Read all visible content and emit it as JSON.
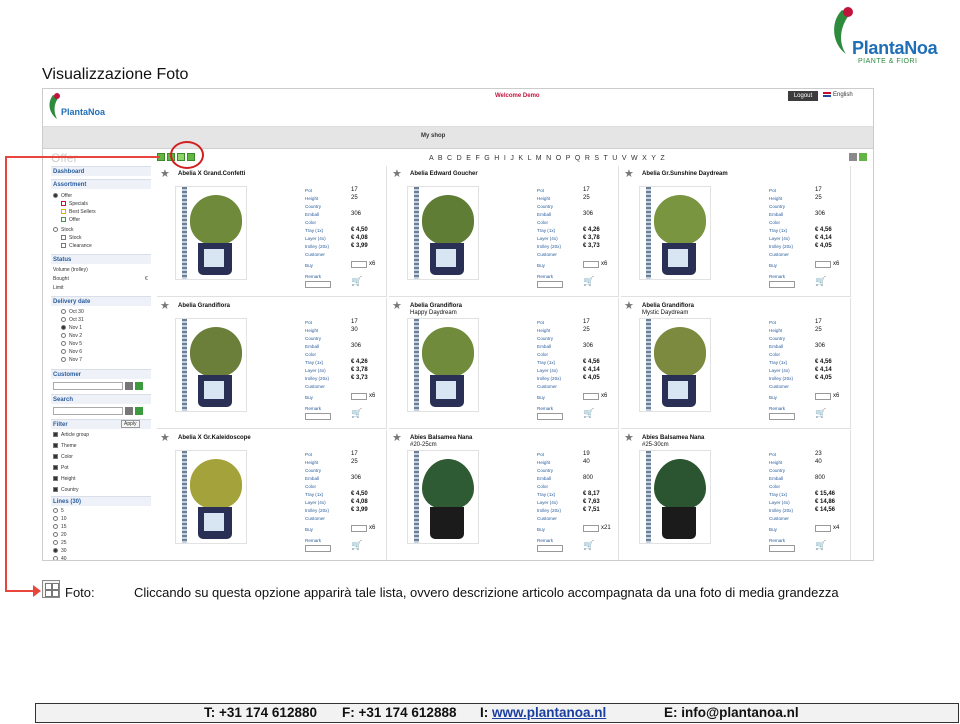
{
  "brand": {
    "name": "PlantaNoa",
    "tagline": "PIANTE & FIORI"
  },
  "doc_title": "Visualizzazione Foto",
  "app": {
    "logo_name": "PlantaNoa",
    "welcome": "Welcome Demo",
    "logout": "Logout",
    "language": "English",
    "shop_title": "My shop",
    "offer_title": "Offer",
    "alphabet": "A B C D E F G H I J K L M N O P Q R S T U V W X Y Z"
  },
  "sidebar": {
    "dashboard": "Dashboard",
    "assortment": "Assortment",
    "offer": "Offer",
    "specials": "Specials",
    "best_sellers": "Best Sellers",
    "offer2": "Offer",
    "stock_group": "Stock",
    "stock": "Stock",
    "clearance": "Clearance",
    "status": "Status",
    "volume": "Volume (trolley)",
    "bought": "Bought",
    "bought_sym": "€",
    "limit": "Limit",
    "delivery_date": "Delivery date",
    "dates": [
      "Oct 30",
      "Oct 31",
      "Nov 1",
      "Nov 2",
      "Nov 5",
      "Nov 6",
      "Nov 7"
    ],
    "customer": "Customer",
    "search": "Search",
    "filter": "Filter",
    "apply": "Apply",
    "filters": [
      "Article group",
      "Theme",
      "Color",
      "Pot",
      "Height",
      "Country"
    ],
    "lines": "Lines (30)",
    "line_options": [
      "5",
      "10",
      "15",
      "20",
      "25",
      "30",
      "40"
    ]
  },
  "spec_labels": {
    "pot": "Pot",
    "height": "Height",
    "country": "Country",
    "emball": "Emball",
    "color": "Color",
    "tray": "Tray (1x)",
    "layer": "Layer (4x)",
    "trolley": "trolley (20x)",
    "customer": "Customer",
    "buy": "Buy",
    "remark": "Remark"
  },
  "products": [
    {
      "name": "Abelia X Grand.Confetti",
      "sub": "",
      "pot": "17",
      "height": "25",
      "emball": "306",
      "tray": "€ 4,50",
      "layer": "€ 4,08",
      "trolley": "€ 3,99",
      "mult": "x6",
      "leaf": "#6e8a3a"
    },
    {
      "name": "Abelia Edward Goucher",
      "sub": "",
      "pot": "17",
      "height": "25",
      "emball": "306",
      "tray": "€ 4,26",
      "layer": "€ 3,78",
      "trolley": "€ 3,73",
      "mult": "x6",
      "leaf": "#5f7d34"
    },
    {
      "name": "Abelia Gr.Sunshine Daydream",
      "sub": "",
      "pot": "17",
      "height": "25",
      "emball": "306",
      "tray": "€ 4,56",
      "layer": "€ 4,14",
      "trolley": "€ 4,05",
      "mult": "x6",
      "leaf": "#7a9540"
    },
    {
      "name": "Abelia Grandiflora",
      "sub": "",
      "pot": "17",
      "height": "30",
      "emball": "306",
      "tray": "€ 4,26",
      "layer": "€ 3,78",
      "trolley": "€ 3,73",
      "mult": "x6",
      "leaf": "#6b7e3a"
    },
    {
      "name": "Abelia Grandiflora",
      "sub": "Happy Daydream",
      "pot": "17",
      "height": "25",
      "emball": "306",
      "tray": "€ 4,56",
      "layer": "€ 4,14",
      "trolley": "€ 4,05",
      "mult": "x6",
      "leaf": "#708b3c"
    },
    {
      "name": "Abelia Grandiflora",
      "sub": "Mystic Daydream",
      "pot": "17",
      "height": "25",
      "emball": "306",
      "tray": "€ 4,56",
      "layer": "€ 4,14",
      "trolley": "€ 4,05",
      "mult": "x6",
      "leaf": "#7b8a3e"
    },
    {
      "name": "Abelia X Gr.Kaleidoscope",
      "sub": "",
      "pot": "17",
      "height": "25",
      "emball": "306",
      "tray": "€ 4,50",
      "layer": "€ 4,08",
      "trolley": "€ 3,99",
      "mult": "x6",
      "leaf": "#a4a23a"
    },
    {
      "name": "Abies Balsamea Nana",
      "sub": "#20-25cm",
      "pot": "19",
      "height": "40",
      "emball": "800",
      "tray": "€ 8,17",
      "layer": "€ 7,63",
      "trolley": "€ 7,51",
      "mult": "x21",
      "leaf": "#2f5b34"
    },
    {
      "name": "Abies Balsamea Nana",
      "sub": "#25-30cm",
      "pot": "23",
      "height": "40",
      "emball": "800",
      "tray": "€ 15,46",
      "layer": "€ 14,86",
      "trolley": "€ 14,56",
      "mult": "x4",
      "leaf": "#2b5530"
    }
  ],
  "caption": {
    "label": "Foto:",
    "text": "Cliccando su questa opzione apparirà tale lista, ovvero descrizione articolo accompagnata da una foto di media grandezza"
  },
  "footer": {
    "phone": "T: +31 174 612880",
    "fax": "F: +31 174 612888",
    "web_prefix": "I: ",
    "web": "www.plantanoa.nl",
    "email": "E: info@plantanoa.nl"
  },
  "colors": {
    "accent_red": "#e8453c",
    "highlight_green": "#62b544",
    "link_blue": "#2a5d9c"
  }
}
